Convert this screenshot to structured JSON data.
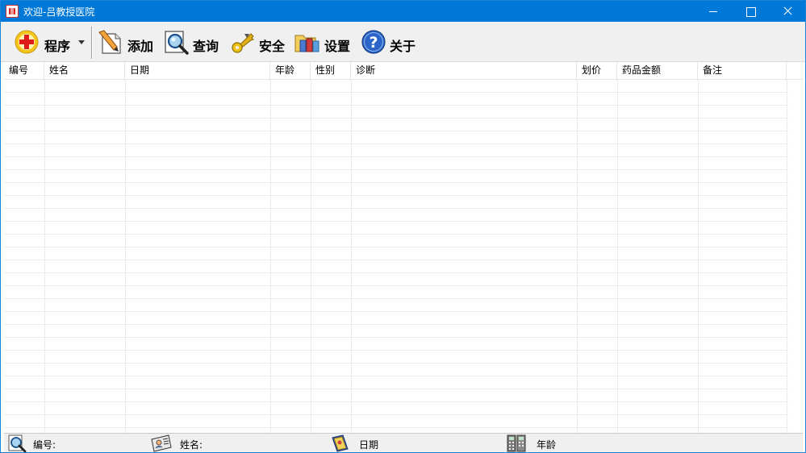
{
  "window": {
    "title": "欢迎-吕教授医院",
    "controls": {
      "minimize": "minimize",
      "maximize": "maximize",
      "close": "close"
    }
  },
  "toolbar": {
    "items": [
      {
        "label": "程序",
        "icon": "red-cross-icon",
        "has_dropdown": true
      },
      {
        "label": "添加",
        "icon": "pencil-paper-icon"
      },
      {
        "label": "查询",
        "icon": "magnifier-icon"
      },
      {
        "label": "安全",
        "icon": "key-icon"
      },
      {
        "label": "设置",
        "icon": "folder-settings-icon"
      },
      {
        "label": "关于",
        "icon": "help-icon"
      }
    ]
  },
  "table": {
    "columns": [
      "编号",
      "姓名",
      "日期",
      "年龄",
      "性别",
      "诊断",
      "划价",
      "药品金额",
      "备注"
    ],
    "rows": []
  },
  "statusbar": {
    "fields": [
      {
        "label": "编号:",
        "icon": "magnifier-icon"
      },
      {
        "label": "姓名:",
        "icon": "id-card-icon"
      },
      {
        "label": "日期",
        "icon": "book-icon"
      },
      {
        "label": "年龄",
        "icon": "calculator-icon"
      }
    ]
  },
  "colors": {
    "titlebar": "#0078d7",
    "toolbar_bg": "#f0f0f0",
    "grid_line": "#ebebeb"
  }
}
